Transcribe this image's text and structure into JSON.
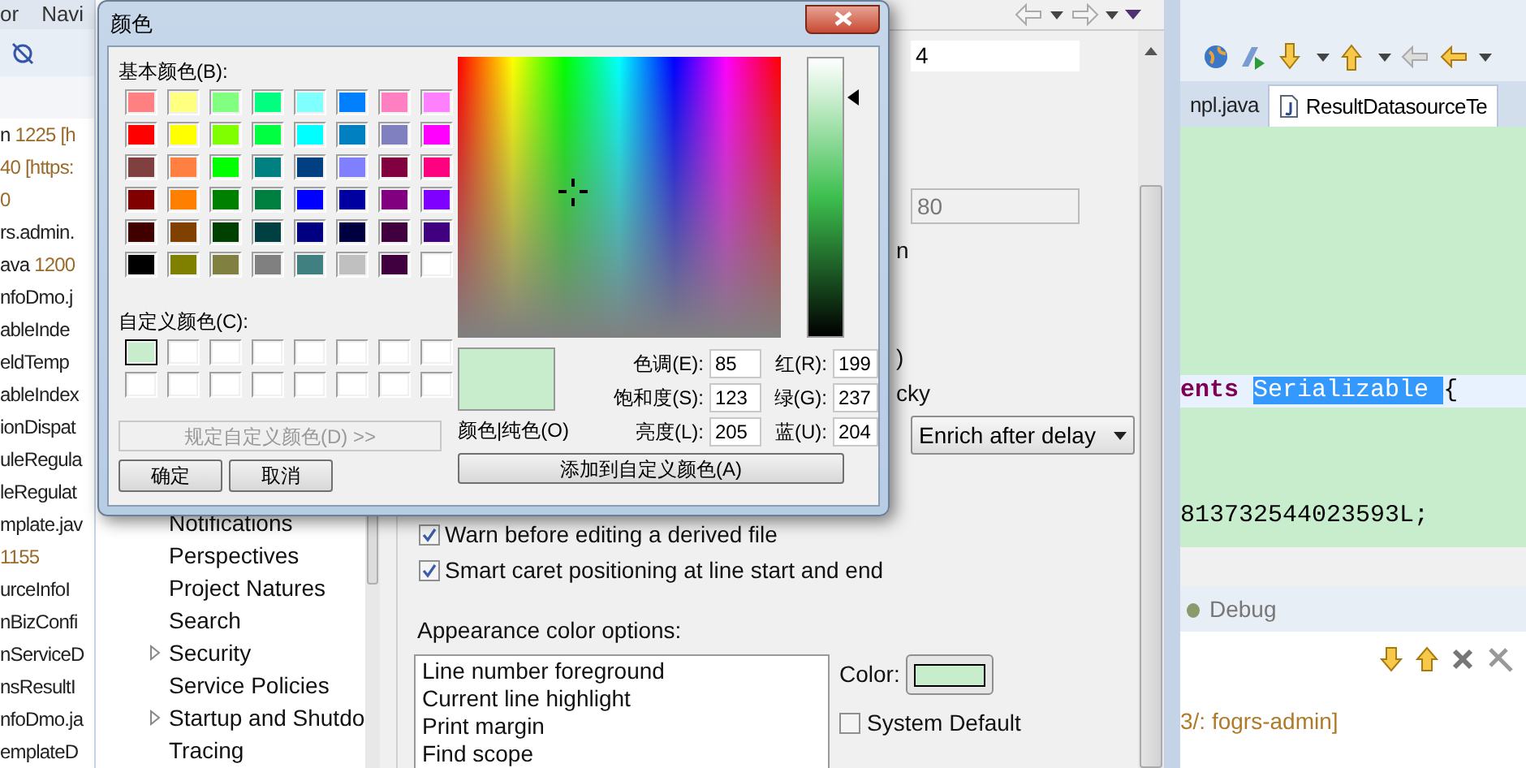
{
  "eclipse": {
    "menu": [
      "or",
      "Navi"
    ],
    "console_lines": [
      {
        "prefix": "n",
        "text": "1225 [h",
        "kind": "info"
      },
      {
        "text": "40 [https:",
        "kind": "info"
      },
      {
        "text": "0",
        "kind": "info"
      },
      {
        "text": "rs.admin.",
        "kind": "plain"
      },
      {
        "prefix": "ava",
        "text": "1200",
        "kind": "info"
      },
      {
        "text": "nfoDmo.j",
        "kind": "plain"
      },
      {
        "text": "ableInde",
        "kind": "plain"
      },
      {
        "text": "eldTemp",
        "kind": "plain"
      },
      {
        "text": "ableIndex",
        "kind": "plain"
      },
      {
        "text": "ionDispat",
        "kind": "plain"
      },
      {
        "text": "uleRegula",
        "kind": "plain"
      },
      {
        "text": "leRegulat",
        "kind": "plain"
      },
      {
        "text": "mplate.jav",
        "kind": "plain"
      },
      {
        "text": "1155",
        "kind": "info"
      },
      {
        "text": "urceInfoI",
        "kind": "plain"
      },
      {
        "text": "nBizConfi",
        "kind": "plain"
      },
      {
        "text": "nServiceD",
        "kind": "plain"
      },
      {
        "text": "nsResultI",
        "kind": "plain"
      },
      {
        "text": "nfoDmo.ja",
        "kind": "plain"
      },
      {
        "text": "emplateD",
        "kind": "plain"
      }
    ],
    "editor_tabs": [
      {
        "label": "npl.java",
        "selected": false
      },
      {
        "label": "ResultDatasourceTe",
        "selected": true
      }
    ],
    "code_lines": [
      {
        "current": true,
        "tokens": [
          {
            "text": "ents",
            "kind": "keyword"
          },
          {
            "text": "Serializable",
            "kind": "selection"
          },
          {
            "text": "{",
            "kind": "plain"
          }
        ]
      },
      {
        "current": false,
        "tokens": [
          {
            "text": "813732544023593L;",
            "kind": "plain"
          }
        ]
      }
    ],
    "debug": {
      "tab": "Debug",
      "text": "3/: fogrs-admin]"
    }
  },
  "preferences": {
    "tree": [
      {
        "label": "Notifications",
        "expandable": false
      },
      {
        "label": "Perspectives",
        "expandable": false
      },
      {
        "label": "Project Natures",
        "expandable": false
      },
      {
        "label": "Search",
        "expandable": false
      },
      {
        "label": "Security",
        "expandable": true
      },
      {
        "label": "Service Policies",
        "expandable": false
      },
      {
        "label": "Startup and Shutdo",
        "expandable": true
      },
      {
        "label": "Tracing",
        "expandable": false
      }
    ],
    "fields": [
      {
        "value": "4",
        "disabled": false
      },
      {
        "value": "80",
        "disabled": true
      }
    ],
    "partial_labels": [
      "n",
      ")",
      "cky"
    ],
    "dropdown": "Enrich after delay",
    "checkboxes": [
      {
        "label": "Warn before editing a derived file",
        "checked": true
      },
      {
        "label": "Smart caret positioning at line start and end",
        "checked": true
      }
    ],
    "appearance_label": "Appearance color options:",
    "color_options": [
      "Line number foreground",
      "Current line highlight",
      "Print margin",
      "Find scope"
    ],
    "color_label": "Color:",
    "system_default": {
      "label": "System Default",
      "checked": false
    }
  },
  "color_dialog": {
    "title": "颜色",
    "basic_label": "基本颜色(B):",
    "basic_colors": [
      [
        {
          "color": "#ff8080",
          "selected": false
        },
        {
          "color": "#ffff80",
          "selected": false
        },
        {
          "color": "#80ff80",
          "selected": false
        },
        {
          "color": "#00ff80",
          "selected": false
        },
        {
          "color": "#80ffff",
          "selected": false
        },
        {
          "color": "#0080ff",
          "selected": false
        },
        {
          "color": "#ff80c0",
          "selected": false
        },
        {
          "color": "#ff80ff",
          "selected": false
        }
      ],
      [
        {
          "color": "#ff0000",
          "selected": false
        },
        {
          "color": "#ffff00",
          "selected": false
        },
        {
          "color": "#80ff00",
          "selected": false
        },
        {
          "color": "#00ff40",
          "selected": false
        },
        {
          "color": "#00ffff",
          "selected": false
        },
        {
          "color": "#0080c0",
          "selected": false
        },
        {
          "color": "#8080c0",
          "selected": false
        },
        {
          "color": "#ff00ff",
          "selected": false
        }
      ],
      [
        {
          "color": "#804040",
          "selected": false
        },
        {
          "color": "#ff8040",
          "selected": false
        },
        {
          "color": "#00ff00",
          "selected": false
        },
        {
          "color": "#008080",
          "selected": false
        },
        {
          "color": "#004080",
          "selected": false
        },
        {
          "color": "#8080ff",
          "selected": false
        },
        {
          "color": "#800040",
          "selected": false
        },
        {
          "color": "#ff0080",
          "selected": false
        }
      ],
      [
        {
          "color": "#800000",
          "selected": false
        },
        {
          "color": "#ff8000",
          "selected": false
        },
        {
          "color": "#008000",
          "selected": false
        },
        {
          "color": "#008040",
          "selected": false
        },
        {
          "color": "#0000ff",
          "selected": false
        },
        {
          "color": "#0000a0",
          "selected": false
        },
        {
          "color": "#800080",
          "selected": false
        },
        {
          "color": "#8000ff",
          "selected": false
        }
      ],
      [
        {
          "color": "#400000",
          "selected": false
        },
        {
          "color": "#804000",
          "selected": false
        },
        {
          "color": "#004000",
          "selected": false
        },
        {
          "color": "#004040",
          "selected": false
        },
        {
          "color": "#000080",
          "selected": false
        },
        {
          "color": "#000040",
          "selected": false
        },
        {
          "color": "#400040",
          "selected": false
        },
        {
          "color": "#400080",
          "selected": false
        }
      ],
      [
        {
          "color": "#000000",
          "selected": false
        },
        {
          "color": "#808000",
          "selected": false
        },
        {
          "color": "#808040",
          "selected": false
        },
        {
          "color": "#808080",
          "selected": false
        },
        {
          "color": "#408080",
          "selected": false
        },
        {
          "color": "#c0c0c0",
          "selected": false
        },
        {
          "color": "#400040",
          "selected": false
        },
        {
          "color": "#ffffff",
          "selected": false
        }
      ]
    ],
    "custom_label": "自定义颜色(C):",
    "custom_colors": [
      [
        {
          "color": "#c7edcc",
          "selected": true
        },
        {
          "color": "#ffffff",
          "selected": false
        },
        {
          "color": "#ffffff",
          "selected": false
        },
        {
          "color": "#ffffff",
          "selected": false
        },
        {
          "color": "#ffffff",
          "selected": false
        },
        {
          "color": "#ffffff",
          "selected": false
        },
        {
          "color": "#ffffff",
          "selected": false
        },
        {
          "color": "#ffffff",
          "selected": false
        }
      ],
      [
        {
          "color": "#ffffff",
          "selected": false
        },
        {
          "color": "#ffffff",
          "selected": false
        },
        {
          "color": "#ffffff",
          "selected": false
        },
        {
          "color": "#ffffff",
          "selected": false
        },
        {
          "color": "#ffffff",
          "selected": false
        },
        {
          "color": "#ffffff",
          "selected": false
        },
        {
          "color": "#ffffff",
          "selected": false
        },
        {
          "color": "#ffffff",
          "selected": false
        }
      ]
    ],
    "define_button": "规定自定义颜色(D) >>",
    "ok": "确定",
    "cancel": "取消",
    "preview_label": "颜色|纯色(O)",
    "values": [
      {
        "label": "色调(E):",
        "value": "85"
      },
      {
        "label": "红(R):",
        "value": "199"
      },
      {
        "label": "饱和度(S):",
        "value": "123"
      },
      {
        "label": "绿(G):",
        "value": "237"
      },
      {
        "label": "亮度(L):",
        "value": "205"
      },
      {
        "label": "蓝(U):",
        "value": "204"
      }
    ],
    "add_button": "添加到自定义颜色(A)"
  }
}
